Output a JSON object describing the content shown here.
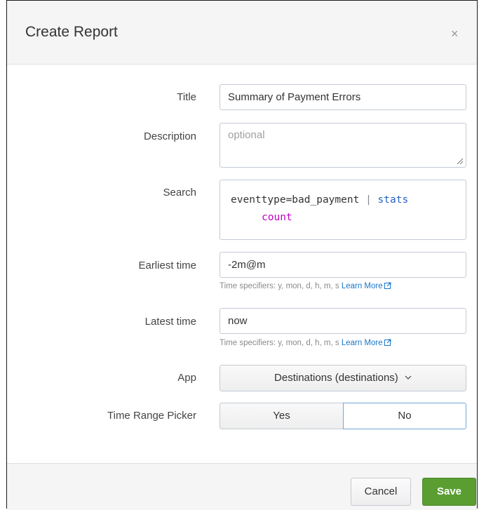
{
  "dialog": {
    "title": "Create Report",
    "close_glyph": "×"
  },
  "form": {
    "title": {
      "label": "Title",
      "value": "Summary of Payment Errors"
    },
    "description": {
      "label": "Description",
      "placeholder": "optional"
    },
    "search": {
      "label": "Search",
      "query_field": "eventtype=bad_payment",
      "pipe": "|",
      "command": "stats",
      "function": "count"
    },
    "earliest_time": {
      "label": "Earliest time",
      "value": "-2m@m",
      "help": "Time specifiers: y, mon, d, h, m, s",
      "help_link": "Learn More"
    },
    "latest_time": {
      "label": "Latest time",
      "value": "now",
      "help": "Time specifiers: y, mon, d, h, m, s",
      "help_link": "Learn More"
    },
    "app": {
      "label": "App",
      "selected": "Destinations (destinations)"
    },
    "time_range_picker": {
      "label": "Time Range Picker",
      "options": [
        "Yes",
        "No"
      ],
      "selected": "No"
    }
  },
  "footer": {
    "cancel_label": "Cancel",
    "save_label": "Save"
  },
  "colors": {
    "save_button": "#5a9e32",
    "link": "#1a77c9",
    "search_command": "#2662c0",
    "search_function": "#c000c0"
  }
}
